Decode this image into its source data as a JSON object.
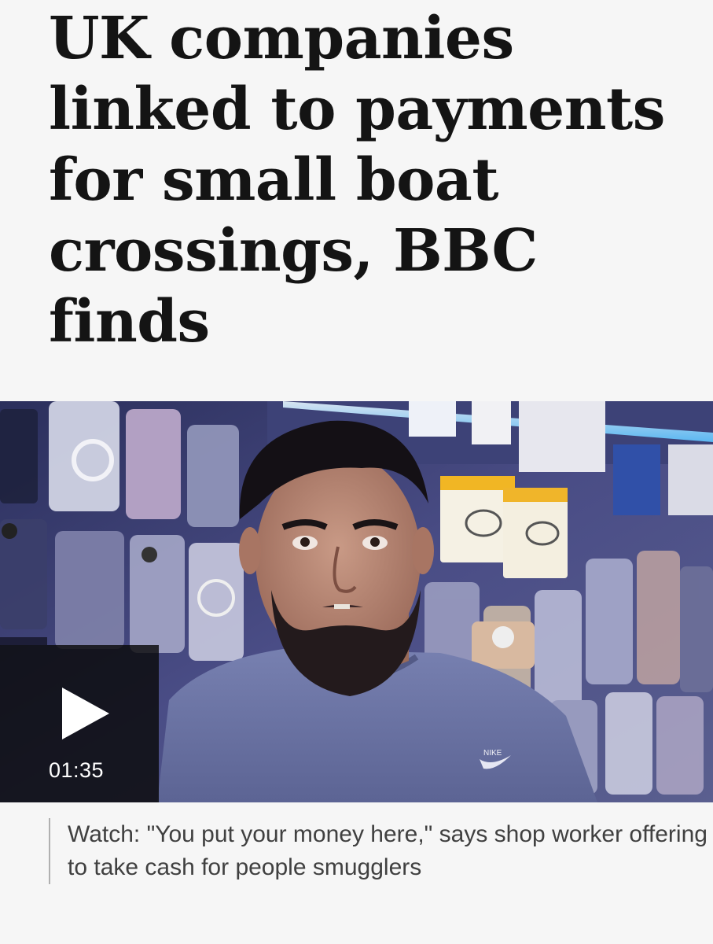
{
  "article": {
    "headline_lines": [
      "UK companies",
      "linked to payments",
      "for small boat",
      "crossings, BBC",
      "finds"
    ]
  },
  "video": {
    "duration": "01:35",
    "play_icon": "play-icon",
    "thumbnail_description_hidden": false,
    "logo_on_shirt": "NIKE"
  },
  "caption": {
    "text": "Watch: \"You put your money here,\" says shop worker offering to take cash for people smugglers"
  },
  "colors": {
    "background": "#f6f6f6",
    "headline": "#141414",
    "caption": "#404040",
    "caption_rule": "#b0b0b0"
  }
}
